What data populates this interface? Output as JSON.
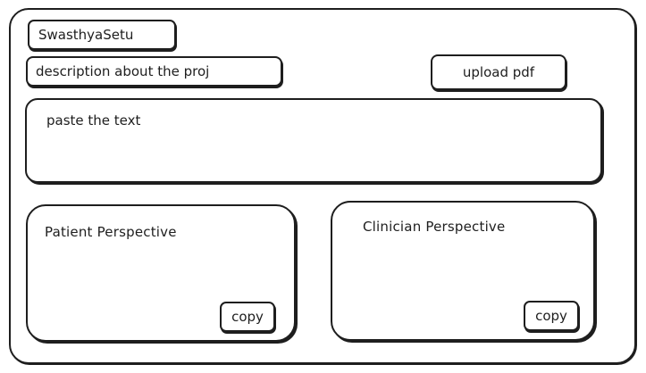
{
  "app": {
    "title": "SwasthyaSetu"
  },
  "header": {
    "description_label": "description about the proj",
    "upload_label": "upload pdf"
  },
  "input": {
    "placeholder": "paste the text",
    "value": ""
  },
  "panels": {
    "patient": {
      "title": "Patient Perspective",
      "copy_label": "copy"
    },
    "clinician": {
      "title": "Clinician Perspective",
      "copy_label": "copy"
    }
  }
}
